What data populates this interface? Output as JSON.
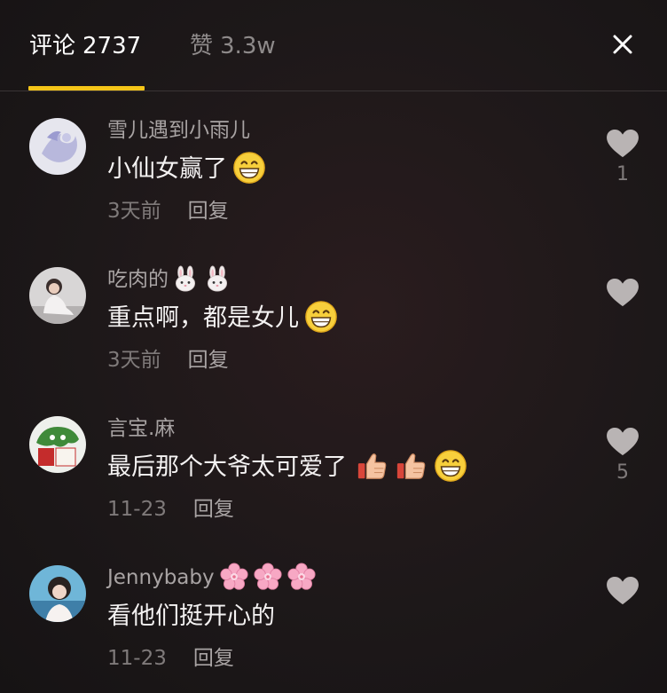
{
  "header": {
    "tab_comments_label": "评论",
    "tab_comments_count": "2737",
    "tab_likes_label": "赞",
    "tab_likes_count": "3.3w",
    "accent_color": "#f5c518"
  },
  "comments": [
    {
      "username": "雪儿遇到小雨儿",
      "text": "小仙女赢了",
      "emojis": [
        "grin-emoji"
      ],
      "time": "3天前",
      "reply_label": "回复",
      "like_count": "1"
    },
    {
      "username": "吃肉的",
      "username_emojis": [
        "rabbit-emoji",
        "rabbit-emoji"
      ],
      "text": "重点啊，都是女儿",
      "emojis": [
        "grin-emoji"
      ],
      "time": "3天前",
      "reply_label": "回复",
      "like_count": ""
    },
    {
      "username": "言宝.麻",
      "text": "最后那个大爷太可爱了",
      "emojis": [
        "thumbs-up-emoji",
        "thumbs-up-emoji",
        "grin-emoji"
      ],
      "time": "11-23",
      "reply_label": "回复",
      "like_count": "5"
    },
    {
      "username": "Jennybaby",
      "username_emojis": [
        "cherry-blossom-emoji",
        "cherry-blossom-emoji",
        "cherry-blossom-emoji"
      ],
      "text": "看他们挺开心的",
      "emojis": [],
      "time": "11-23",
      "reply_label": "回复",
      "like_count": ""
    }
  ],
  "icons": {
    "close": "close-icon",
    "like": "heart-icon"
  }
}
